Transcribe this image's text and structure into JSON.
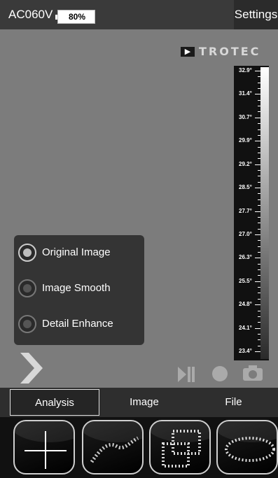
{
  "status_bar": {
    "device_model": "AC060V",
    "battery": {
      "level_percent": 80,
      "label": "80%"
    },
    "settings_label": "Settings"
  },
  "viewer": {
    "logo_text": "TROTEC",
    "temperature_scale": [
      "32.9°",
      "31.4°",
      "30.7°",
      "29.9°",
      "29.2°",
      "28.5°",
      "27.7°",
      "27.0°",
      "26.3°",
      "25.5°",
      "24.8°",
      "24.1°",
      "23.4°"
    ],
    "image_modes": [
      {
        "label": "Original Image",
        "selected": true
      },
      {
        "label": "Image Smooth",
        "selected": false
      },
      {
        "label": "Detail Enhance",
        "selected": false
      }
    ]
  },
  "tabs": [
    {
      "label": "Analysis",
      "active": true
    },
    {
      "label": "Image",
      "active": false
    },
    {
      "label": "File",
      "active": false
    }
  ],
  "tools": [
    "crosshair-point",
    "line-curve",
    "rectangle-area",
    "ellipse-area"
  ]
}
